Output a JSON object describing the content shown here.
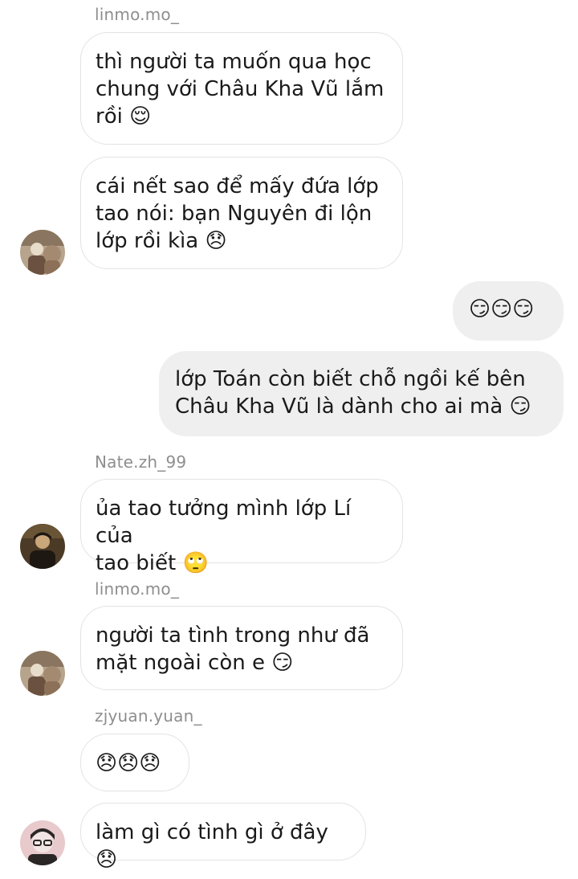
{
  "messages": [
    {
      "sender": "linmo.mo_",
      "text": "thì người ta muốn qua học\nchung với Châu Kha Vũ lắm\nrồi 😌"
    },
    {
      "text": "cái nết sao để mấy đứa lớp\ntao nói: bạn Nguyên đi lộn\nlớp rồi kìa 😞"
    },
    {
      "text": "😏😏😏"
    },
    {
      "text": "lớp Toán còn biết chỗ ngồi kế bên\nChâu Kha Vũ là dành cho ai mà 😏"
    },
    {
      "sender": "Nate.zh_99",
      "text": "ủa tao tưởng mình lớp Lí của\ntao biết 🙄"
    },
    {
      "sender": "linmo.mo_",
      "text": "người ta tình trong như đã\nmặt ngoài còn e 😏"
    },
    {
      "sender": "zjyuan.yuan_",
      "text": "😞😞😞"
    },
    {
      "text": "làm gì có tình gì ở đây 😞"
    }
  ],
  "avatars": [
    {
      "user": "linmo.mo_",
      "icon": "profile-photo-icon",
      "colors": [
        "#b7a48c",
        "#6b5240",
        "#e8dccb"
      ]
    },
    {
      "user": "Nate.zh_99",
      "icon": "profile-photo-icon",
      "colors": [
        "#4b3a26",
        "#1d1812",
        "#c9a77a"
      ]
    },
    {
      "user": "zjyuan.yuan_",
      "icon": "profile-photo-icon",
      "colors": [
        "#e8c9cc",
        "#2a2626",
        "#f2e6e4"
      ]
    }
  ]
}
